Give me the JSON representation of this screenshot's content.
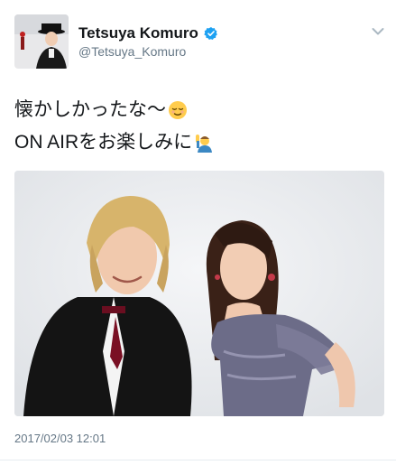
{
  "tweet": {
    "display_name": "Tetsuya Komuro",
    "handle": "@Tetsuya_Komuro",
    "verified": true,
    "text_line1": "懐かしかったな〜",
    "text_line2": "ON AIRをお楽しみに",
    "emoji1": "relieved-face-emoji",
    "emoji2": "person-raising-hand-emoji",
    "timestamp": "2017/02/03 12:01"
  },
  "icons": {
    "verified": "verified-badge-icon",
    "menu": "chevron-down-icon"
  },
  "colors": {
    "name": "#14171a",
    "secondary": "#657786",
    "verified": "#1da1f2",
    "photo_background": "#e9ecf0"
  }
}
